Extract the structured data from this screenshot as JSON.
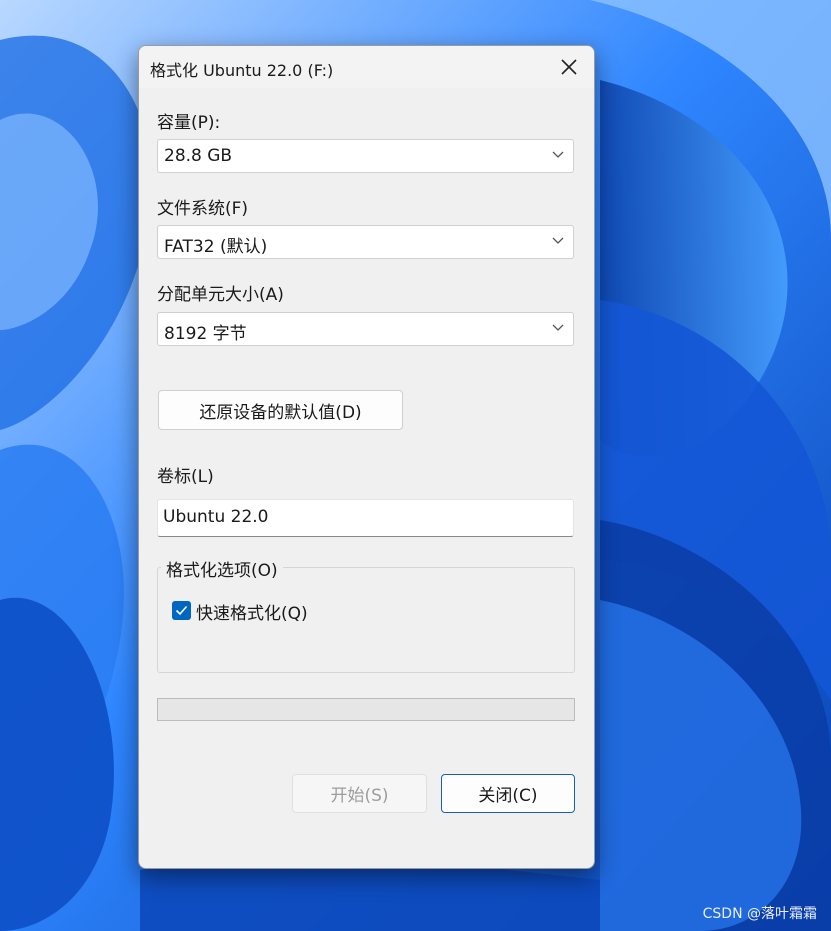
{
  "dialog": {
    "title": "格式化 Ubuntu 22.0 (F:)",
    "capacity": {
      "label": "容量(P):",
      "value": "28.8 GB"
    },
    "file_system": {
      "label": "文件系统(F)",
      "value": "FAT32 (默认)"
    },
    "allocation_unit": {
      "label": "分配单元大小(A)",
      "value": "8192 字节"
    },
    "restore_defaults_label": "还原设备的默认值(D)",
    "volume_label": {
      "label": "卷标(L)",
      "value": "Ubuntu 22.0"
    },
    "format_options": {
      "legend": "格式化选项(O)",
      "quick_format": {
        "label": "快速格式化(Q)",
        "checked": true
      }
    },
    "progress": 0,
    "start_label": "开始(S)",
    "close_label": "关闭(C)"
  },
  "watermark": "CSDN @落叶霜霜",
  "colors": {
    "accent": "#0067c0",
    "wallpaper": "#0b5fd8"
  }
}
